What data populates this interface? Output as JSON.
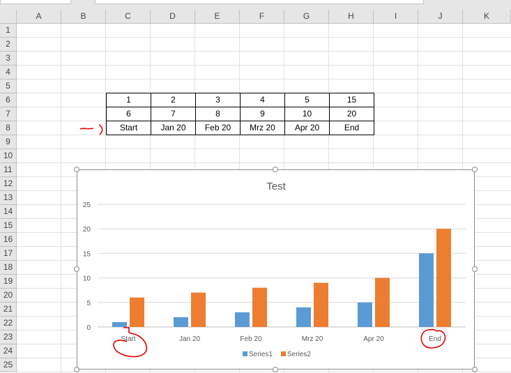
{
  "columns": [
    "A",
    "B",
    "C",
    "D",
    "E",
    "F",
    "G",
    "H",
    "I",
    "J",
    "K"
  ],
  "rows": [
    "1",
    "2",
    "3",
    "4",
    "5",
    "6",
    "7",
    "8",
    "9",
    "10",
    "11",
    "12",
    "13",
    "14",
    "15",
    "16",
    "17",
    "18",
    "19",
    "20",
    "21",
    "22",
    "23",
    "24",
    "25"
  ],
  "table": {
    "row6": [
      "1",
      "2",
      "3",
      "4",
      "5",
      "15"
    ],
    "row7": [
      "6",
      "7",
      "8",
      "9",
      "10",
      "20"
    ],
    "row8": [
      "Start",
      "Jan 20",
      "Feb 20",
      "Mrz 20",
      "Apr 20",
      "End"
    ]
  },
  "colors": {
    "series1": "#5b9bd5",
    "series2": "#ed7d31",
    "annotation": "#e00000",
    "gridline": "#d9d9d9"
  },
  "chart_data": {
    "type": "bar",
    "title": "Test",
    "categories": [
      "Start",
      "Jan 20",
      "Feb 20",
      "Mrz 20",
      "Apr 20",
      "End"
    ],
    "series": [
      {
        "name": "Series1",
        "values": [
          1,
          2,
          3,
          4,
          5,
          15
        ]
      },
      {
        "name": "Series2",
        "values": [
          6,
          7,
          8,
          9,
          10,
          20
        ]
      }
    ],
    "ylim": [
      0,
      25
    ],
    "yticks": [
      "0",
      "5",
      "10",
      "15",
      "20",
      "25"
    ],
    "grid": true,
    "legend": "bottom"
  }
}
